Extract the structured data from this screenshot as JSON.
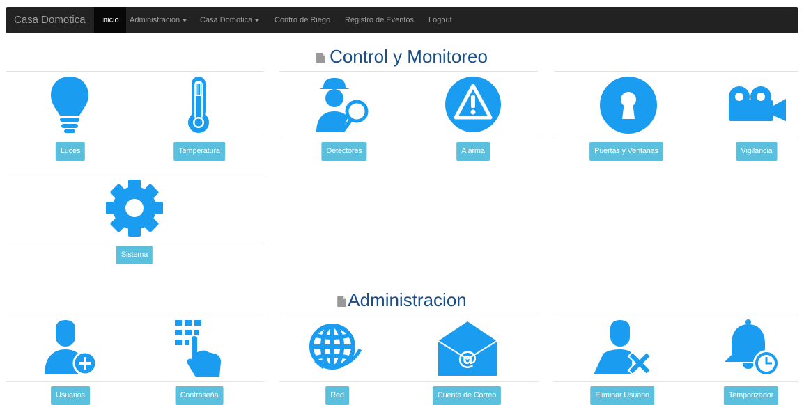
{
  "navbar": {
    "brand": "Casa Domotica",
    "items": [
      {
        "label": "Inicio",
        "active": true
      },
      {
        "label": "Administracion",
        "dropdown": true
      },
      {
        "label": "Casa Domotica",
        "dropdown": true
      },
      {
        "label": "Contro de Riego"
      },
      {
        "label": "Registro de Eventos"
      },
      {
        "label": "Logout"
      }
    ]
  },
  "sections": {
    "control": {
      "title": "Control y Monitoreo",
      "tiles": [
        {
          "label": "Luces",
          "icon": "lightbulb-icon"
        },
        {
          "label": "Temperatura",
          "icon": "thermometer-icon"
        },
        {
          "label": "Detectores",
          "icon": "detective-icon"
        },
        {
          "label": "Alarma",
          "icon": "alarm-warning-icon"
        },
        {
          "label": "Puertas y Ventanas",
          "icon": "keyhole-icon"
        },
        {
          "label": "Vigilancia",
          "icon": "video-camera-icon"
        },
        {
          "label": "Sistema",
          "icon": "gear-icon"
        }
      ]
    },
    "admin": {
      "title": "Administracion",
      "tiles": [
        {
          "label": "Usuarios",
          "icon": "add-user-icon"
        },
        {
          "label": "Contraseña",
          "icon": "keypad-icon"
        },
        {
          "label": "Red",
          "icon": "globe-icon"
        },
        {
          "label": "Cuenta de Correo",
          "icon": "email-envelope-icon"
        },
        {
          "label": "Eliminar Usuario",
          "icon": "remove-user-icon"
        },
        {
          "label": "Temporizador",
          "icon": "bell-timer-icon"
        }
      ]
    }
  },
  "colors": {
    "icon": "#1a9df0",
    "button": "#5bc0de",
    "title": "#1a4f8b",
    "navbar": "#222222"
  }
}
